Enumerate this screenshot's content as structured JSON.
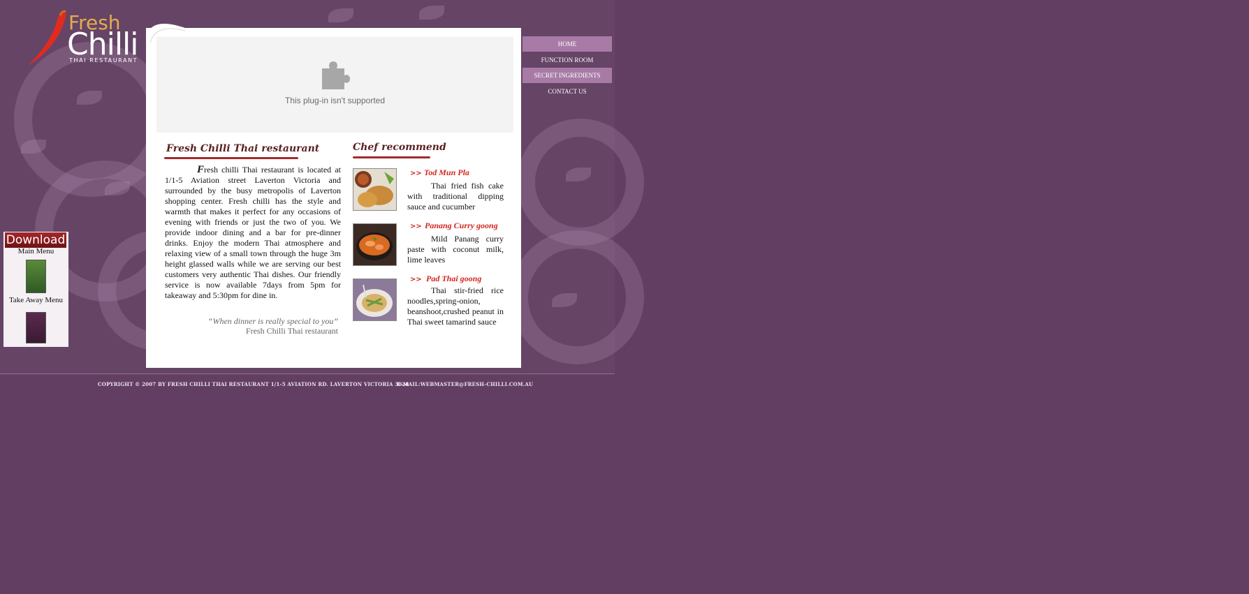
{
  "logo": {
    "fresh": "Fresh",
    "chilli": "Chilli",
    "subtitle": "THAI RESTAURANT"
  },
  "plugin": {
    "message": "This plug-in isn't supported",
    "icon": "puzzle-piece-icon"
  },
  "nav": [
    {
      "label": "HOME"
    },
    {
      "label": "FUNCTION ROOM"
    },
    {
      "label": "SECRET INGREDIENTS"
    },
    {
      "label": "CONTACT US"
    }
  ],
  "intro": {
    "heading": "Fresh Chilli Thai restaurant",
    "dropcap": "F",
    "body": "resh chilli Thai restaurant is located at 1/1-5 Aviation street Laverton Victoria and surrounded by the busy metropolis of Laverton shopping center. Fresh chilli has the style and warmth that makes it perfect for any occasions of evening with friends or just the two of you. We provide indoor dining and a bar for pre-dinner drinks. Enjoy the modern Thai atmosphere and relaxing view of a small town through the huge 3m height glassed walls while we are serving our best customers very authentic Thai dishes. Our friendly service is now available 7days from 5pm for takeaway and 5:30pm for dine in.",
    "quote": "“When dinner is really special to you”",
    "signature": "Fresh Chilli Thai restaurant"
  },
  "chef": {
    "heading": "Chef recommend",
    "arrow": ">>",
    "dishes": [
      {
        "name": "Tod Mun Pla",
        "description": "Thai fried fish cake with traditional dipping sauce and cucumber"
      },
      {
        "name": "Panang Curry goong",
        "description": "Mild Panang curry paste with coconut milk, lime leaves"
      },
      {
        "name": "Pad Thai goong",
        "description": "Thai stir-fried rice noodles,spring-onion, beanshoot,crushed peanut in Thai sweet tamarind sauce"
      }
    ]
  },
  "download": {
    "title": "Download",
    "main_menu": "Main Menu",
    "takeaway_menu": "Take Away Menu"
  },
  "footer": {
    "copyright": "COPYRIGHT © 2007 BY FRESH CHILLI THAI RESTAURANT 1/1-5 AVIATION RD. LAVERTON VICTORIA 3028",
    "email": "E-MAIL:WEBMASTER@FRESH-CHILLI.COM.AU"
  },
  "colors": {
    "background": "#623f62",
    "nav_highlight": "#a87ba7",
    "accent_red": "#d2261f",
    "logo_orange": "#e3ad4d"
  }
}
